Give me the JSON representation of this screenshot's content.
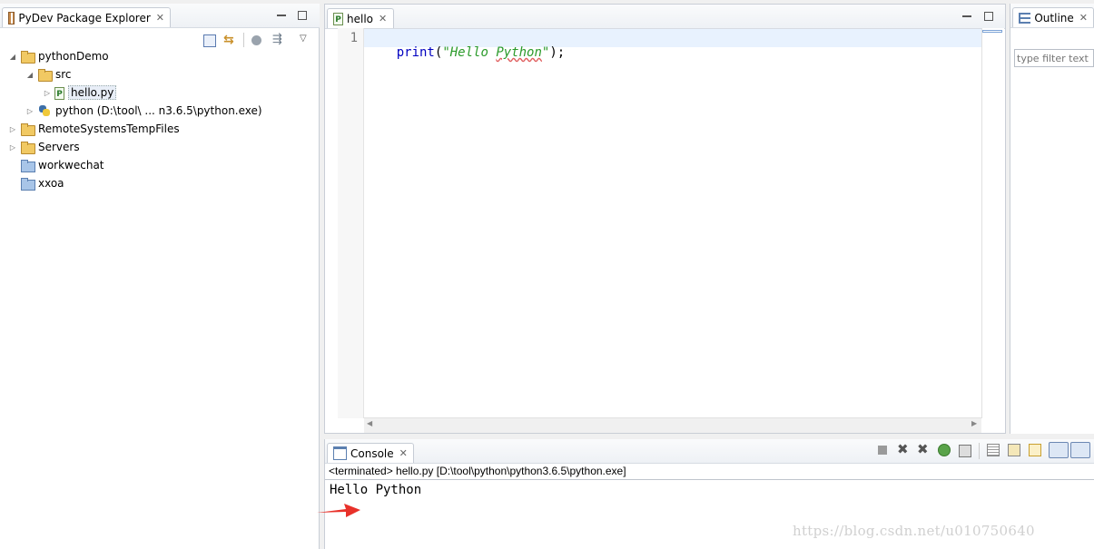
{
  "explorer": {
    "tab_title": "PyDev Package Explorer",
    "tree": [
      {
        "label": "pythonDemo"
      },
      {
        "label": "src"
      },
      {
        "label": "hello.py"
      },
      {
        "label": "python  (D:\\tool\\ ... n3.6.5\\python.exe)"
      },
      {
        "label": "RemoteSystemsTempFiles"
      },
      {
        "label": "Servers"
      },
      {
        "label": "workwechat"
      },
      {
        "label": "xxoa"
      }
    ]
  },
  "editor": {
    "tab_title": "hello",
    "line_number": "1",
    "code": {
      "fn": "print",
      "open": "(",
      "q1": "\"",
      "str_a": "Hello ",
      "str_b": "Python",
      "q2": "\"",
      "close": ");"
    }
  },
  "outline": {
    "tab_title": "Outline",
    "filter_placeholder": "type filter text"
  },
  "console": {
    "tab_title": "Console",
    "status": "<terminated> hello.py [D:\\tool\\python\\python3.6.5\\python.exe]",
    "output": "Hello Python"
  },
  "watermark": "https://blog.csdn.net/u010750640",
  "colors": {
    "keyword": "#0000c0",
    "string": "#2a9a2a",
    "annotation_arrow": "#e8312a"
  }
}
